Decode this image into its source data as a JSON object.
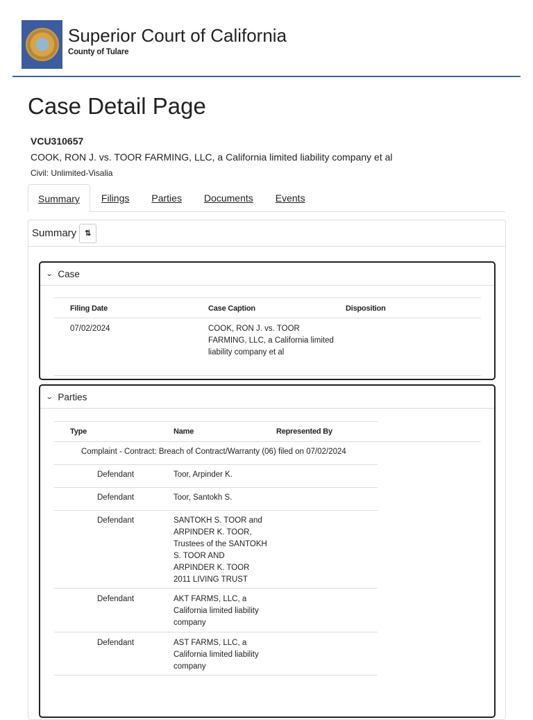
{
  "header": {
    "title": "Superior Court of California",
    "subtitle": "County of Tulare",
    "logo_text": "The Great Seal of the State of California"
  },
  "page_title": "Case Detail Page",
  "case": {
    "number": "VCU310657",
    "caption": "COOK, RON J. vs. TOOR FARMING, LLC, a California limited liability company et al",
    "type": "Civil: Unlimited-Visalia"
  },
  "tabs": [
    "Summary",
    "Filings",
    "Parties",
    "Documents",
    "Events"
  ],
  "summary": {
    "title": "Summary",
    "swap_icon": "⇅"
  },
  "case_panel": {
    "title": "Case",
    "headers": [
      "Filing Date",
      "Case Caption",
      "Disposition"
    ],
    "row": {
      "filing_date": "07/02/2024",
      "caption": "COOK, RON J. vs. TOOR FARMING, LLC, a California limited liability company et al",
      "disposition": ""
    }
  },
  "parties_panel": {
    "title": "Parties",
    "headers": [
      "Type",
      "Name",
      "Represented By"
    ],
    "group": "Complaint - Contract: Breach of Contract/Warranty (06) filed on 07/02/2024",
    "rows": [
      {
        "type": "Defendant",
        "name": "Toor, Arpinder K."
      },
      {
        "type": "Defendant",
        "name": "Toor, Santokh S."
      },
      {
        "type": "Defendant",
        "name": "SANTOKH S. TOOR and ARPINDER K. TOOR, Trustees of the SANTOKH S. TOOR AND ARPINDER K. TOOR 2011 LIVING TRUST"
      },
      {
        "type": "Defendant",
        "name": "AKT FARMS, LLC, a California limited liability company"
      },
      {
        "type": "Defendant",
        "name": "AST FARMS, LLC, a California limited liability company"
      }
    ]
  }
}
